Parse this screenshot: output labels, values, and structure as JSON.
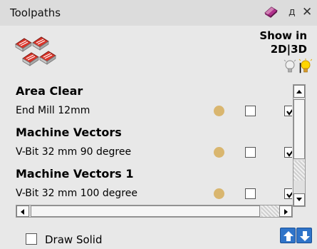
{
  "window": {
    "title": "Toolpaths",
    "icons": [
      "eraser-icon",
      "pin-icon",
      "close-icon"
    ],
    "pin_glyph": "д",
    "close_glyph": "✕"
  },
  "show_in": {
    "line1": "Show in",
    "line2": "2D|3D",
    "separator": "|"
  },
  "list": [
    {
      "type": "group",
      "label": "Area Clear"
    },
    {
      "type": "item",
      "label": "End Mill 12mm",
      "show_2d": false,
      "show_3d": true
    },
    {
      "type": "group",
      "label": "Machine Vectors"
    },
    {
      "type": "item",
      "label": "V-Bit 32 mm 90 degree",
      "show_2d": false,
      "show_3d": true
    },
    {
      "type": "group",
      "label": "Machine Vectors 1"
    },
    {
      "type": "item",
      "label": "V-Bit 32 mm 100 degree",
      "show_2d": false,
      "show_3d": true
    }
  ],
  "footer": {
    "draw_solid_label": "Draw Solid",
    "draw_solid_checked": false
  },
  "colors": {
    "accent_blue": "#2f74c9",
    "dot": "#d9b66f"
  }
}
